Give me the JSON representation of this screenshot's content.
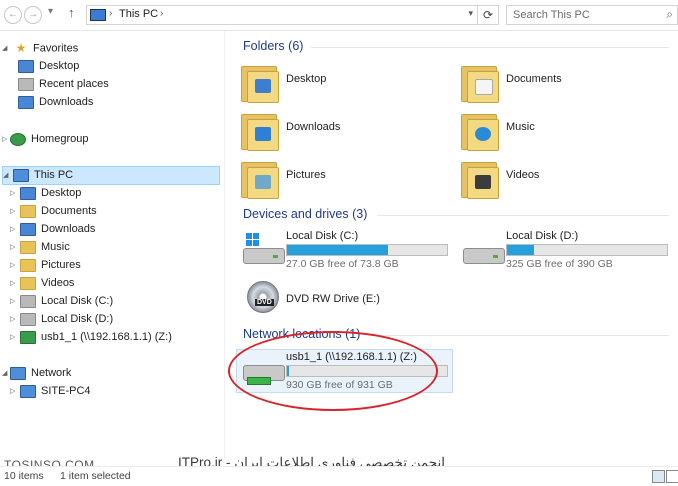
{
  "address": {
    "path": "This PC",
    "search_placeholder": "Search This PC"
  },
  "nav": {
    "favorites": {
      "label": "Favorites",
      "items": [
        "Desktop",
        "Recent places",
        "Downloads"
      ]
    },
    "homegroup": "Homegroup",
    "this_pc": {
      "label": "This PC",
      "items": [
        "Desktop",
        "Documents",
        "Downloads",
        "Music",
        "Pictures",
        "Videos",
        "Local Disk (C:)",
        "Local Disk (D:)",
        "usb1_1 (\\\\192.168.1.1) (Z:)"
      ]
    },
    "network": {
      "label": "Network",
      "items": [
        "SITE-PC4"
      ]
    }
  },
  "content": {
    "folders_header": "Folders (6)",
    "folders": [
      "Desktop",
      "Documents",
      "Downloads",
      "Music",
      "Pictures",
      "Videos"
    ],
    "devices_header": "Devices and drives (3)",
    "drives": [
      {
        "name": "Local Disk (C:)",
        "free": "27.0 GB free of 73.8 GB",
        "used_fraction": 0.63
      },
      {
        "name": "Local Disk (D:)",
        "free": "325 GB free of 390 GB",
        "used_fraction": 0.17
      },
      {
        "name": "DVD RW Drive (E:)"
      }
    ],
    "network_header": "Network locations (1)",
    "network_drive": {
      "name": "usb1_1 (\\\\192.168.1.1) (Z:)",
      "free": "930 GB free of 931 GB",
      "used_fraction": 0.01
    }
  },
  "watermark": {
    "site": "TOSINSO.COM",
    "arabic": "انجمن تخصصی فناوری اطلاعات ایران - ITPro.ir"
  },
  "status": {
    "items": "10 items",
    "selected": "1 item selected"
  },
  "colors": {
    "accent": "#26a0da",
    "selection": "#cce8ff",
    "header": "#1e3b8a",
    "highlight_circle": "#d7262b"
  }
}
